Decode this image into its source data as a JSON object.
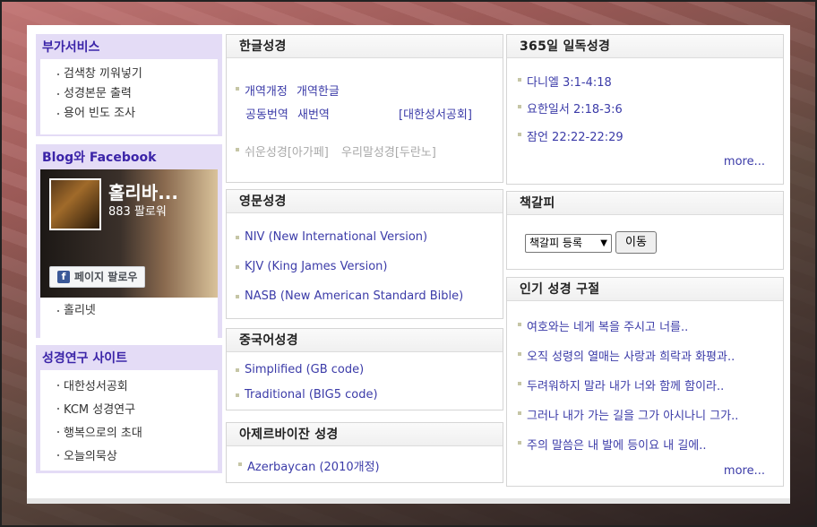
{
  "left": {
    "services": {
      "title": "부가서비스",
      "items": [
        "검색창 끼워넣기",
        "성경본문 출력",
        "용어 빈도 조사"
      ]
    },
    "social": {
      "title": "Blog와 Facebook",
      "page_name": "홀리바...",
      "followers": "883 팔로워",
      "follow_button": "페이지 팔로우",
      "items": [
        "홀리넷"
      ]
    },
    "research": {
      "title": "성경연구 사이트",
      "items": [
        "대한성서공회",
        "KCM 성경연구",
        "행복으로의 초대",
        "오늘의묵상"
      ]
    }
  },
  "korean": {
    "title": "한글성경",
    "row1": [
      "개역개정",
      "개역한글"
    ],
    "row2": [
      "공동번역",
      "새번역"
    ],
    "publisher": "[대한성서공회]",
    "row3": [
      "쉬운성경[아가페]",
      "우리말성경[두란노]"
    ]
  },
  "english": {
    "title": "영문성경",
    "items": [
      "NIV (New International Version)",
      "KJV (King James Version)",
      "NASB (New American Standard Bible)"
    ]
  },
  "chinese": {
    "title": "중국어성경",
    "items": [
      "Simplified (GB code)",
      "Traditional (BIG5 code)"
    ]
  },
  "azerbaijani": {
    "title": "아제르바이잔 성경",
    "items": [
      "Azerbaycan (2010개정)"
    ]
  },
  "daily": {
    "title": "365일 일독성경",
    "items": [
      "다니엘 3:1-4:18",
      "요한일서 2:18-3:6",
      "잠언 22:22-22:29"
    ],
    "more": "more..."
  },
  "bookmark": {
    "title": "책갈피",
    "select_value": "책갈피 등록",
    "go_button": "이동"
  },
  "popular": {
    "title": "인기 성경 구절",
    "items": [
      "여호와는 네게 복을 주시고 너를..",
      "오직 성령의 열매는 사랑과 희락과 화평과..",
      "두려워하지 말라 내가 너와 함께 함이라..",
      "그러나 내가 가는 길을 그가 아시나니 그가..",
      "주의 말씀은 내 발에 등이요 내 길에.."
    ],
    "more": "more..."
  }
}
